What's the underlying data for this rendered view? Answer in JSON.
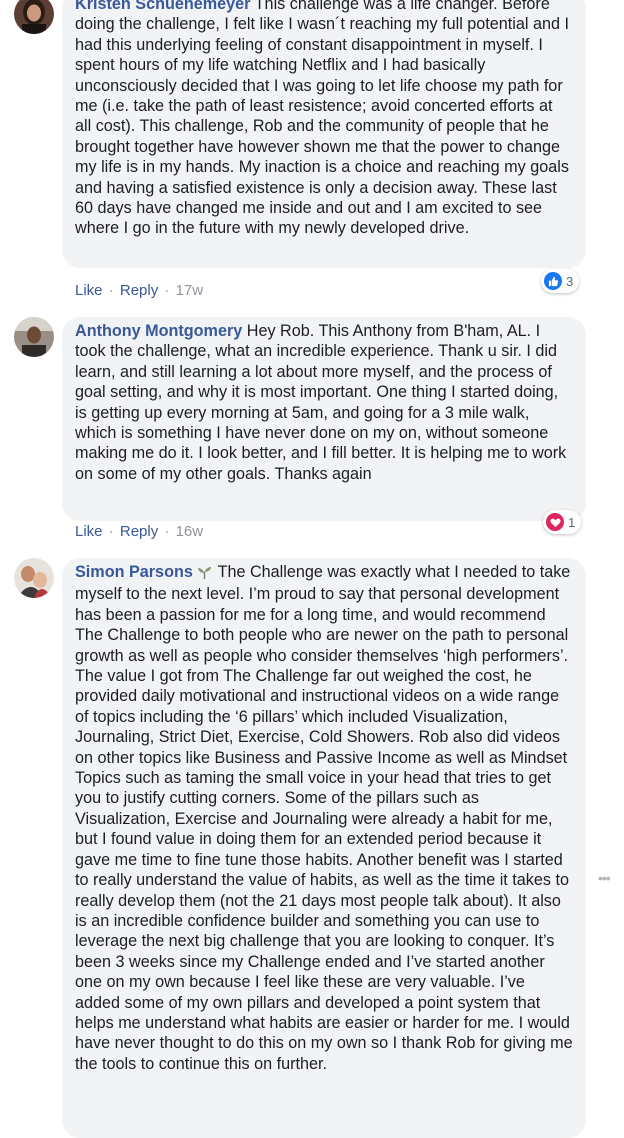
{
  "comments": [
    {
      "author": "Kristen Schuenemeyer",
      "text": "This challenge was a life changer. Before doing the challenge, I felt like I wasn´t reaching my full potential and I had this underlying feeling of constant disappointment in myself. I spent hours of my life watching Netflix and I had basically unconsciously decided that I was going to let life choose my path for me (i.e. take the path of least resistence; avoid concerted efforts at all cost). This challenge, Rob and the community of people that he brought together have however shown me that the power to change my life is in my hands. My inaction is a choice and reaching my goals and having a satisfied existence is only a decision away. These last 60 days have changed me inside and out and I am excited to see where I go in the future with my newly developed drive.",
      "like_label": "Like",
      "reply_label": "Reply",
      "time": "17w",
      "reaction_icon": "like-thumb-icon",
      "reaction_color": "#1877f2",
      "reaction_count": "3"
    },
    {
      "author": "Anthony Montgomery",
      "text": "Hey Rob. This Anthony from B'ham, AL. I took the challenge, what an incredible experience. Thank u sir. I did learn, and still learning a lot about more myself, and the process of goal setting, and why it is most important. One thing I started doing, is getting up every morning at 5am, and going for a 3 mile walk, which is something I have never done on my on, without someone making me do it. I look better, and I fill better. It is helping me to work on some of my other goals. Thanks again",
      "like_label": "Like",
      "reply_label": "Reply",
      "time": "16w",
      "reaction_icon": "love-heart-icon",
      "reaction_color": "#e0245e",
      "reaction_count": "1"
    },
    {
      "author": "Simon Parsons",
      "author_suffix_icon": "seedling-icon",
      "text": "The Challenge was exactly what I needed to take myself to the next level. I’m proud to say that personal development has been a passion for me for a long time, and would recommend The Challenge to both people who are newer on the path to personal growth as well as people who consider themselves ‘high performers’. The value I got from The Challenge far out weighed the cost, he provided daily motivational and instructional videos on a wide range of topics including the ‘6 pillars’ which included Visualization, Journaling, Strict Diet, Exercise, Cold Showers. Rob also did videos on other topics like Business and Passive Income as well as Mindset Topics such as taming the small voice in your head that tries to get you to justify cutting corners. Some of the pillars such as Visualization, Exercise and Journaling were already a habit for me, but I found value in doing them for an extended period because it gave me time to fine tune those habits. Another benefit was I started to really understand the value of habits, as well as the time it takes to really develop them (not the 21 days most people talk about). It also is an incredible confidence builder and something you can use to leverage the next big challenge that you are looking to conquer. It’s been 3 weeks since my Challenge ended and I’ve started another one on my own because I feel like these are very valuable. I’ve added some of my own pillars and developed a point system that helps me understand what habits are easier or harder for me. I would have never thought to do this on my own so I thank Rob for giving me the tools to continue this on further."
    }
  ],
  "separator": "·",
  "more_icon": "more-options-icon"
}
